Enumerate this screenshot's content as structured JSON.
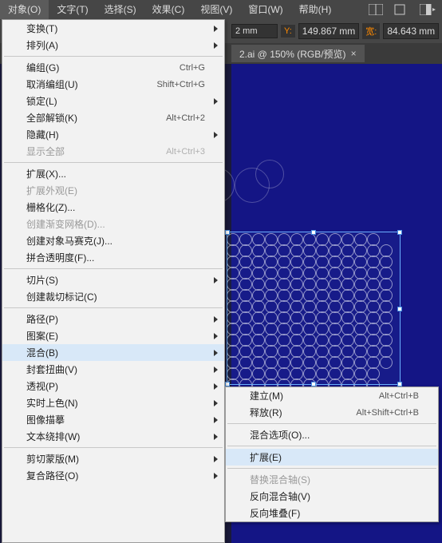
{
  "menubar": {
    "items": [
      "对象(O)",
      "文字(T)",
      "选择(S)",
      "效果(C)",
      "视图(V)",
      "窗口(W)",
      "帮助(H)"
    ],
    "active_index": 0
  },
  "propbar": {
    "x_suffix": "2 mm",
    "y_label": "Y:",
    "y_value": "149.867",
    "y_unit": "mm",
    "w_label": "宽:",
    "w_value": "84.643",
    "w_unit": "mm"
  },
  "tab": {
    "title": "2.ai @ 150% (RGB/预览)",
    "close": "×"
  },
  "menu1": [
    {
      "t": "sub",
      "label": "变换(T)"
    },
    {
      "t": "sub",
      "label": "排列(A)"
    },
    {
      "t": "sep"
    },
    {
      "t": "sc",
      "label": "编组(G)",
      "sc": "Ctrl+G"
    },
    {
      "t": "sc",
      "label": "取消编组(U)",
      "sc": "Shift+Ctrl+G"
    },
    {
      "t": "sub",
      "label": "锁定(L)"
    },
    {
      "t": "sc",
      "label": "全部解锁(K)",
      "sc": "Alt+Ctrl+2"
    },
    {
      "t": "sub",
      "label": "隐藏(H)"
    },
    {
      "t": "scdis",
      "label": "显示全部",
      "sc": "Alt+Ctrl+3"
    },
    {
      "t": "sep"
    },
    {
      "t": "item",
      "label": "扩展(X)..."
    },
    {
      "t": "dis",
      "label": "扩展外观(E)"
    },
    {
      "t": "item",
      "label": "栅格化(Z)..."
    },
    {
      "t": "dis",
      "label": "创建渐变网格(D)..."
    },
    {
      "t": "item",
      "label": "创建对象马赛克(J)..."
    },
    {
      "t": "item",
      "label": "拼合透明度(F)..."
    },
    {
      "t": "sep"
    },
    {
      "t": "sub",
      "label": "切片(S)"
    },
    {
      "t": "item",
      "label": "创建裁切标记(C)"
    },
    {
      "t": "sep"
    },
    {
      "t": "sub",
      "label": "路径(P)"
    },
    {
      "t": "sub",
      "label": "图案(E)"
    },
    {
      "t": "subhl",
      "label": "混合(B)"
    },
    {
      "t": "sub",
      "label": "封套扭曲(V)"
    },
    {
      "t": "sub",
      "label": "透视(P)"
    },
    {
      "t": "sub",
      "label": "实时上色(N)"
    },
    {
      "t": "sub",
      "label": "图像描摹"
    },
    {
      "t": "sub",
      "label": "文本绕排(W)"
    },
    {
      "t": "sep"
    },
    {
      "t": "sub",
      "label": "剪切蒙版(M)"
    },
    {
      "t": "sub",
      "label": "复合路径(O)"
    }
  ],
  "menu2": [
    {
      "t": "sc",
      "label": "建立(M)",
      "sc": "Alt+Ctrl+B"
    },
    {
      "t": "sc",
      "label": "释放(R)",
      "sc": "Alt+Shift+Ctrl+B"
    },
    {
      "t": "sep"
    },
    {
      "t": "item",
      "label": "混合选项(O)..."
    },
    {
      "t": "sep"
    },
    {
      "t": "hl",
      "label": "扩展(E)"
    },
    {
      "t": "sep"
    },
    {
      "t": "dis",
      "label": "替换混合轴(S)"
    },
    {
      "t": "item",
      "label": "反向混合轴(V)"
    },
    {
      "t": "item",
      "label": "反向堆叠(F)"
    }
  ]
}
